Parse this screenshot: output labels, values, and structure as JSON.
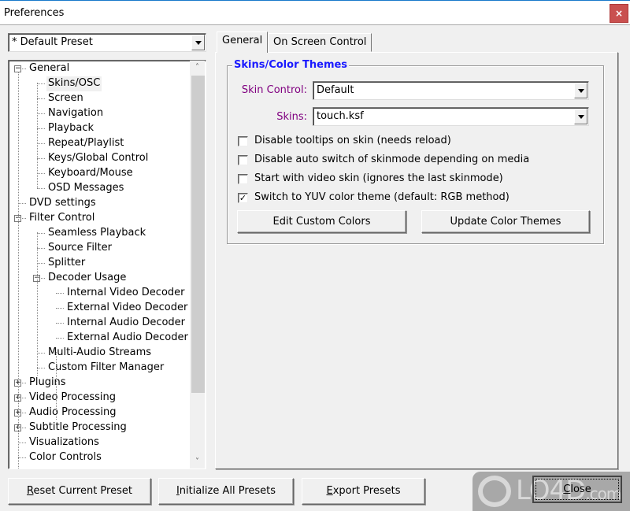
{
  "window": {
    "title": "Preferences",
    "close_glyph": "×"
  },
  "preset_combo": {
    "value": "* Default Preset"
  },
  "tree": {
    "items": [
      {
        "label": "General",
        "level": 0,
        "expander": "minus"
      },
      {
        "label": "Skins/OSC",
        "level": 1,
        "selected": true
      },
      {
        "label": "Screen",
        "level": 1
      },
      {
        "label": "Navigation",
        "level": 1
      },
      {
        "label": "Playback",
        "level": 1
      },
      {
        "label": "Repeat/Playlist",
        "level": 1
      },
      {
        "label": "Keys/Global Control",
        "level": 1
      },
      {
        "label": "Keyboard/Mouse",
        "level": 1
      },
      {
        "label": "OSD Messages",
        "level": 1
      },
      {
        "label": "DVD settings",
        "level": 0
      },
      {
        "label": "Filter Control",
        "level": 0,
        "expander": "minus"
      },
      {
        "label": "Seamless Playback",
        "level": 1
      },
      {
        "label": "Source Filter",
        "level": 1
      },
      {
        "label": "Splitter",
        "level": 1
      },
      {
        "label": "Decoder Usage",
        "level": 1,
        "expander": "minus"
      },
      {
        "label": "Internal Video Decoder",
        "level": 2
      },
      {
        "label": "External Video Decoder",
        "level": 2
      },
      {
        "label": "Internal Audio Decoder",
        "level": 2
      },
      {
        "label": "External Audio Decoder",
        "level": 2
      },
      {
        "label": "Multi-Audio Streams",
        "level": 1
      },
      {
        "label": "Custom Filter Manager",
        "level": 1
      },
      {
        "label": "Plugins",
        "level": 0,
        "expander": "plus"
      },
      {
        "label": "Video Processing",
        "level": 0,
        "expander": "plus"
      },
      {
        "label": "Audio Processing",
        "level": 0,
        "expander": "plus"
      },
      {
        "label": "Subtitle Processing",
        "level": 0,
        "expander": "plus"
      },
      {
        "label": "Visualizations",
        "level": 0
      },
      {
        "label": "Color Controls",
        "level": 0
      }
    ],
    "scroll_up_glyph": "˄",
    "scroll_down_glyph": "˅"
  },
  "tabs": [
    {
      "label": "General",
      "active": true
    },
    {
      "label": "On Screen Control",
      "active": false
    }
  ],
  "skins_group": {
    "title": "Skins/Color Themes",
    "skin_control_label": "Skin Control:",
    "skin_control_value": "Default",
    "skins_label": "Skins:",
    "skins_value": "touch.ksf",
    "checkboxes": [
      {
        "label": "Disable tooltips on skin (needs reload)",
        "checked": false
      },
      {
        "label": "Disable auto switch of skinmode depending on media",
        "checked": false
      },
      {
        "label": "Start with video skin (ignores the last skinmode)",
        "checked": false
      },
      {
        "label": "Switch to YUV color theme (default: RGB method)",
        "checked": true
      }
    ],
    "check_glyph": "✓",
    "edit_colors_label": "Edit Custom Colors",
    "update_themes_label": "Update Color Themes"
  },
  "footer": {
    "reset_label_accel": "R",
    "reset_label_rest": "eset Current Preset",
    "init_label_accel": "I",
    "init_label_rest": "nitialize All Presets",
    "export_label_accel": "E",
    "export_label_rest": "xport Presets",
    "close_label_accel": "C",
    "close_label_rest": "lose"
  },
  "watermark": {
    "text": "LO4D",
    "suffix": ".com"
  }
}
